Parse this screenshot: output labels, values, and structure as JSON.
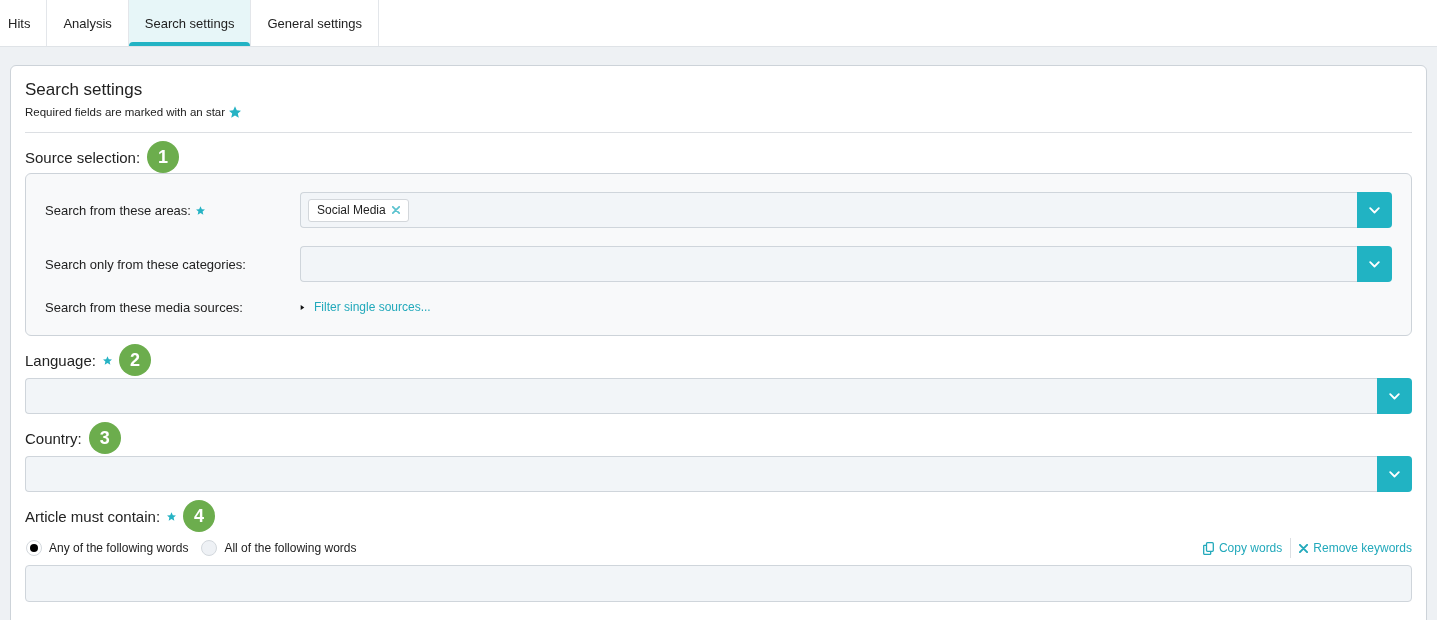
{
  "tabs": [
    {
      "label": "Hits",
      "selected": false
    },
    {
      "label": "Analysis",
      "selected": false
    },
    {
      "label": "Search settings",
      "selected": true
    },
    {
      "label": "General settings",
      "selected": false
    }
  ],
  "panel": {
    "title": "Search settings",
    "note": "Required fields are marked with an star"
  },
  "sections": [
    {
      "kind": "group",
      "label": "Source selection:",
      "required": false,
      "step": "1",
      "rows": [
        {
          "kind": "select",
          "label": "Search from these areas:",
          "required": true,
          "chips": [
            "Social Media"
          ]
        },
        {
          "kind": "select",
          "label": "Search only from these categories:",
          "required": false
        },
        {
          "kind": "link",
          "label": "Search from these media sources:",
          "required": false,
          "link": "Filter single sources...",
          "expanded": false
        }
      ]
    },
    {
      "kind": "select",
      "label": "Language:",
      "required": true,
      "step": "2"
    },
    {
      "kind": "select",
      "label": "Country:",
      "required": false,
      "step": "3"
    },
    {
      "kind": "keywords",
      "label": "Article must contain:",
      "required": true,
      "step": "4",
      "options": [
        {
          "label": "Any of the following words",
          "selected": true
        },
        {
          "label": "All of the following words",
          "selected": false
        }
      ],
      "actions": [
        {
          "kind": "copy",
          "label": "Copy words"
        },
        {
          "kind": "remove",
          "label": "Remove keywords"
        }
      ]
    }
  ]
}
